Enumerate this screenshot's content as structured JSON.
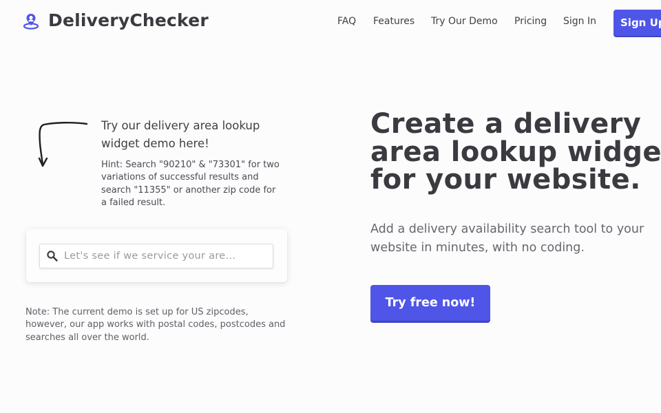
{
  "header": {
    "brand": "DeliveryChecker",
    "nav": {
      "faq": "FAQ",
      "features": "Features",
      "demo": "Try Our Demo",
      "pricing": "Pricing",
      "sign_in": "Sign In",
      "sign_up": "Sign Up"
    }
  },
  "demo": {
    "title": "Try our delivery area lookup widget demo here!",
    "hint": "Hint: Search \"90210\" & \"73301\" for two variations of successful results and search \"11355\" or another zip code for a failed result.",
    "search": {
      "placeholder": "Let's see if we service your are...",
      "value": ""
    },
    "note": "Note: The current demo is set up for US zipcodes, however, our app works with postal codes, postcodes and searches all over the world."
  },
  "hero": {
    "title_lines": [
      "Create a delivery",
      "area lookup widget",
      "for your website."
    ],
    "subtitle": "Add a delivery availability search tool to your website in minutes, with no coding.",
    "cta": "Try free now!"
  },
  "icons": {
    "logo": "map-pin-person-icon",
    "search": "search-icon",
    "arrow": "hand-drawn-arrow-icon"
  },
  "colors": {
    "accent": "#4f55e6",
    "text_dark": "#3a3a40",
    "text_muted": "#66666e",
    "background": "#fcfcfd"
  }
}
